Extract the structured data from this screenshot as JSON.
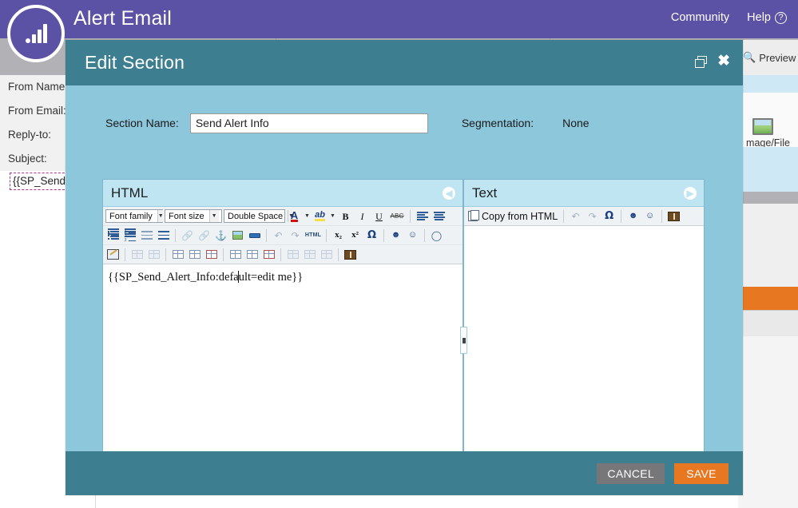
{
  "topbar": {
    "logo_icon": "bar-chart-logo-icon",
    "title": "Alert Email",
    "nav": [
      {
        "label": "Community",
        "icon": ""
      },
      {
        "label": "Help",
        "icon": "help-circle-icon"
      }
    ]
  },
  "background": {
    "form_labels": [
      "From Name:",
      "From Email:",
      "Reply-to:",
      "Subject:"
    ],
    "subject_value": "{{SP_Send",
    "preview_label": "Preview Dra",
    "preview_icon": "magnifier-icon",
    "image_file_label": "mage/File",
    "image_file_icon": "image-file-icon"
  },
  "modal": {
    "title": "Edit Section",
    "restore_icon": "restore-window-icon",
    "close_icon": "close-icon",
    "section_name_label": "Section Name:",
    "section_name_value": "Send Alert Info",
    "section_name_placeholder": "",
    "segmentation_label": "Segmentation:",
    "segmentation_value": "None",
    "splitter_icon": "splitter-grip-icon",
    "footer": {
      "cancel_label": "CANCEL",
      "save_label": "SAVE"
    }
  },
  "html_pane": {
    "title": "HTML",
    "collapse_icon": "arrow-left-circle-icon",
    "toolbar_row1": [
      {
        "type": "select",
        "name": "font-family-select",
        "value": "Font family"
      },
      {
        "type": "select",
        "name": "font-size-select",
        "value": "Font size"
      },
      {
        "type": "select",
        "name": "line-spacing-select",
        "value": "Double Space"
      },
      {
        "type": "button",
        "name": "text-color-button",
        "glyph": "A"
      },
      {
        "type": "caret",
        "name": "text-color-caret",
        "glyph": "▾"
      },
      {
        "type": "button",
        "name": "highlight-color-button",
        "glyph": "ab"
      },
      {
        "type": "caret",
        "name": "highlight-color-caret",
        "glyph": "▾"
      },
      {
        "type": "button",
        "name": "bold-button",
        "glyph": "B"
      },
      {
        "type": "button",
        "name": "italic-button",
        "glyph": "I"
      },
      {
        "type": "button",
        "name": "underline-button",
        "glyph": "U"
      },
      {
        "type": "button",
        "name": "strikethrough-button",
        "glyph": "ABC"
      },
      {
        "type": "sep"
      },
      {
        "type": "button",
        "name": "align-left-button",
        "glyph": "align-left-icon"
      },
      {
        "type": "button",
        "name": "align-center-button",
        "glyph": "align-center-icon"
      },
      {
        "type": "button",
        "name": "align-right-button",
        "glyph": "align-right-icon"
      },
      {
        "type": "button",
        "name": "align-justify-button",
        "glyph": "align-justify-icon"
      }
    ],
    "toolbar_row2": [
      {
        "name": "bullet-list-button"
      },
      {
        "name": "numbered-list-button"
      },
      {
        "name": "outdent-button"
      },
      {
        "name": "indent-button"
      },
      {
        "type": "sep"
      },
      {
        "name": "insert-link-button",
        "disabled": true
      },
      {
        "name": "unlink-button",
        "disabled": true
      },
      {
        "name": "anchor-button"
      },
      {
        "name": "insert-image-button"
      },
      {
        "name": "horizontal-rule-button"
      },
      {
        "type": "sep"
      },
      {
        "name": "undo-button",
        "disabled": true
      },
      {
        "name": "redo-button",
        "disabled": true
      },
      {
        "name": "edit-html-source-button",
        "glyph": "HTML"
      },
      {
        "type": "sep"
      },
      {
        "name": "subscript-button",
        "glyph": "x₂"
      },
      {
        "name": "superscript-button",
        "glyph": "x²"
      },
      {
        "name": "special-character-button",
        "glyph": "Ω"
      },
      {
        "type": "sep"
      },
      {
        "name": "find-button"
      },
      {
        "name": "find-replace-button"
      },
      {
        "type": "sep"
      },
      {
        "name": "remove-formatting-button"
      }
    ],
    "toolbar_row3": [
      {
        "name": "edit-style-button"
      },
      {
        "type": "sep"
      },
      {
        "name": "table-row-properties-button",
        "disabled": true
      },
      {
        "name": "table-cell-properties-button",
        "disabled": true
      },
      {
        "type": "sep"
      },
      {
        "name": "insert-row-before-button"
      },
      {
        "name": "insert-row-after-button"
      },
      {
        "name": "delete-row-button"
      },
      {
        "type": "sep"
      },
      {
        "name": "insert-column-before-button"
      },
      {
        "name": "insert-column-after-button"
      },
      {
        "name": "delete-column-button"
      },
      {
        "type": "sep"
      },
      {
        "name": "split-cells-button",
        "disabled": true
      },
      {
        "name": "merge-cells-button",
        "disabled": true
      },
      {
        "name": "delete-table-button",
        "disabled": true
      },
      {
        "type": "sep"
      },
      {
        "name": "insert-table-button"
      }
    ],
    "content": "{{SP_Send_Alert_Info:default=edit me}}",
    "content_before_caret": "{{SP_Send_Alert_Info:defa",
    "content_after_caret": "ult=edit me}}"
  },
  "text_pane": {
    "title": "Text",
    "expand_icon": "arrow-right-circle-icon",
    "copy_from_html_label": "Copy from HTML",
    "copy_from_html_icon": "copy-icon",
    "toolbar": [
      {
        "name": "undo-button",
        "disabled": true
      },
      {
        "name": "redo-button",
        "disabled": true
      },
      {
        "name": "special-character-button",
        "glyph": "Ω"
      },
      {
        "type": "sep"
      },
      {
        "name": "find-button"
      },
      {
        "name": "find-replace-button"
      },
      {
        "type": "sep"
      },
      {
        "name": "insert-merge-field-button"
      }
    ],
    "content": ""
  },
  "colors": {
    "brand_purple": "#5b51a5",
    "modal_header_teal": "#3d7f91",
    "modal_body_blue": "#8dc7dc",
    "pane_header_blue": "#bfe4f2",
    "accent_orange": "#e87722",
    "cancel_gray": "#77777a"
  }
}
